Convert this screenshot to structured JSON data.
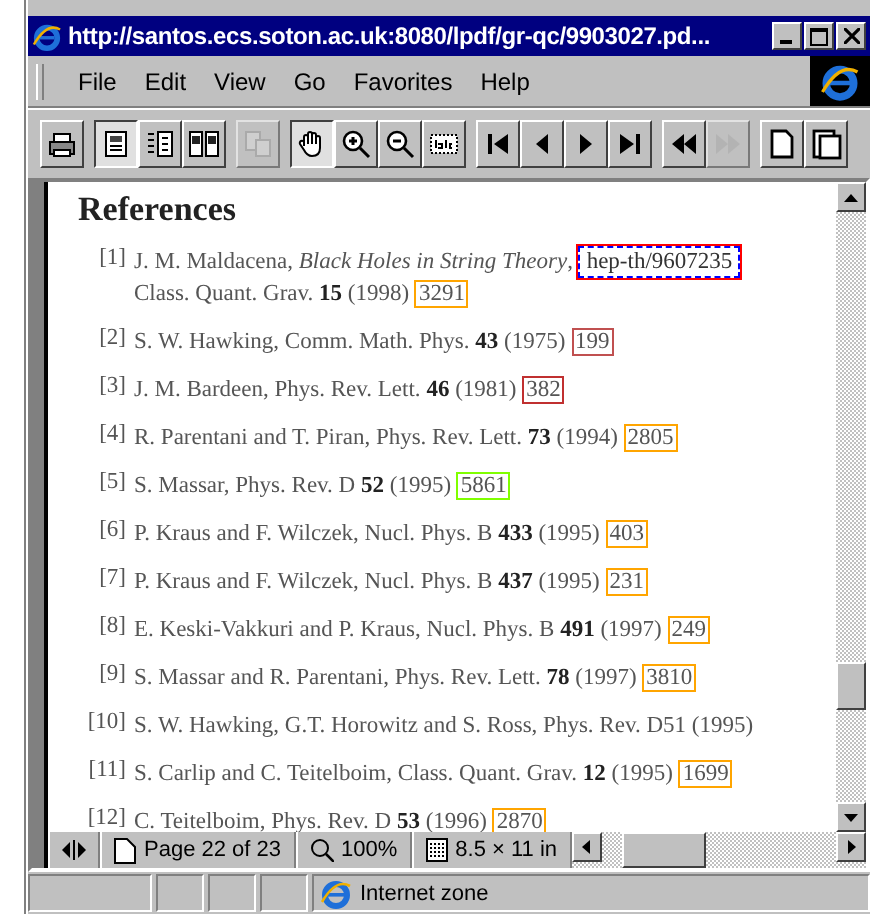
{
  "window": {
    "title": "http://santos.ecs.soton.ac.uk:8080/lpdf/gr-qc/9903027.pd..."
  },
  "menu": [
    {
      "label": "File"
    },
    {
      "label": "Edit"
    },
    {
      "label": "View"
    },
    {
      "label": "Go"
    },
    {
      "label": "Favorites"
    },
    {
      "label": "Help"
    }
  ],
  "toolbar": [
    {
      "kind": "print",
      "selected": false,
      "disabled": false
    },
    {
      "kind": "single-page",
      "selected": true,
      "disabled": false
    },
    {
      "kind": "continuous",
      "selected": false,
      "disabled": false
    },
    {
      "kind": "facing",
      "selected": false,
      "disabled": false
    },
    {
      "kind": "copy",
      "selected": false,
      "disabled": true
    },
    {
      "kind": "hand",
      "selected": true,
      "disabled": false
    },
    {
      "kind": "zoom-in",
      "selected": false,
      "disabled": false
    },
    {
      "kind": "zoom-out",
      "selected": false,
      "disabled": false
    },
    {
      "kind": "text-select",
      "selected": false,
      "disabled": false
    },
    {
      "kind": "first",
      "selected": false,
      "disabled": false
    },
    {
      "kind": "prev",
      "selected": false,
      "disabled": false
    },
    {
      "kind": "next",
      "selected": false,
      "disabled": false
    },
    {
      "kind": "last",
      "selected": false,
      "disabled": false
    },
    {
      "kind": "back",
      "selected": false,
      "disabled": false
    },
    {
      "kind": "forward",
      "selected": false,
      "disabled": true
    },
    {
      "kind": "page",
      "selected": false,
      "disabled": false
    },
    {
      "kind": "page-alt",
      "selected": false,
      "disabled": false
    }
  ],
  "document": {
    "heading": "References",
    "references": [
      {
        "number": "[1]",
        "lines": [
          {
            "text": "J. M. Maldacena, *Black Holes in String Theory*,",
            "link": {
              "text": "hep-th/9607235",
              "color": "#ff0000",
              "dashed": true
            }
          },
          {
            "text": "Class. Quant. Grav. **15** (1998)",
            "link": {
              "text": "3291",
              "color": "#ffa500",
              "dashed": false
            }
          }
        ]
      },
      {
        "number": "[2]",
        "lines": [
          {
            "text": "S. W. Hawking, Comm. Math. Phys. **43** (1975)",
            "link": {
              "text": "199",
              "color": "#c05050",
              "dashed": false
            }
          }
        ]
      },
      {
        "number": "[3]",
        "lines": [
          {
            "text": "J. M. Bardeen, Phys. Rev. Lett. **46** (1981)",
            "link": {
              "text": "382",
              "color": "#c03030",
              "dashed": false
            }
          }
        ]
      },
      {
        "number": "[4]",
        "lines": [
          {
            "text": "R. Parentani and T. Piran, Phys. Rev. Lett. **73** (1994)",
            "link": {
              "text": "2805",
              "color": "#ffa500",
              "dashed": false
            }
          }
        ]
      },
      {
        "number": "[5]",
        "lines": [
          {
            "text": "S. Massar, Phys. Rev. D **52** (1995)",
            "link": {
              "text": "5861",
              "color": "#80ff00",
              "dashed": false
            }
          }
        ]
      },
      {
        "number": "[6]",
        "lines": [
          {
            "text": "P. Kraus and F. Wilczek, Nucl. Phys. B **433** (1995)",
            "link": {
              "text": "403",
              "color": "#ffa500",
              "dashed": false
            }
          }
        ]
      },
      {
        "number": "[7]",
        "lines": [
          {
            "text": "P. Kraus and F. Wilczek, Nucl. Phys. B **437** (1995)",
            "link": {
              "text": "231",
              "color": "#ffa500",
              "dashed": false
            }
          }
        ]
      },
      {
        "number": "[8]",
        "lines": [
          {
            "text": "E. Keski-Vakkuri and P. Kraus, Nucl. Phys. B **491** (1997)",
            "link": {
              "text": "249",
              "color": "#ffa500",
              "dashed": false
            }
          }
        ]
      },
      {
        "number": "[9]",
        "lines": [
          {
            "text": "S. Massar and R. Parentani, Phys. Rev. Lett. **78** (1997)",
            "link": {
              "text": "3810",
              "color": "#ffa500",
              "dashed": false
            }
          }
        ]
      },
      {
        "number": "[10]",
        "lines": [
          {
            "text": "S. W. Hawking, G.T. Horowitz and S. Ross, Phys. Rev. D51 (1995)"
          }
        ]
      },
      {
        "number": "[11]",
        "lines": [
          {
            "text": "S. Carlip and C. Teitelboim, Class. Quant. Grav. **12** (1995)",
            "link": {
              "text": "1699",
              "color": "#ffa500",
              "dashed": false
            }
          }
        ]
      },
      {
        "number": "[12]",
        "lines": [
          {
            "text": "C. Teitelboim, Phys. Rev. D **53** (1996)",
            "link": {
              "text": "2870",
              "color": "#ffa500",
              "dashed": false
            }
          }
        ]
      }
    ]
  },
  "doc_status": {
    "page": "Page 22 of 23",
    "zoom": "100%",
    "page_size": "8.5 × 11 in"
  },
  "status_bar": {
    "zone": "Internet zone"
  }
}
